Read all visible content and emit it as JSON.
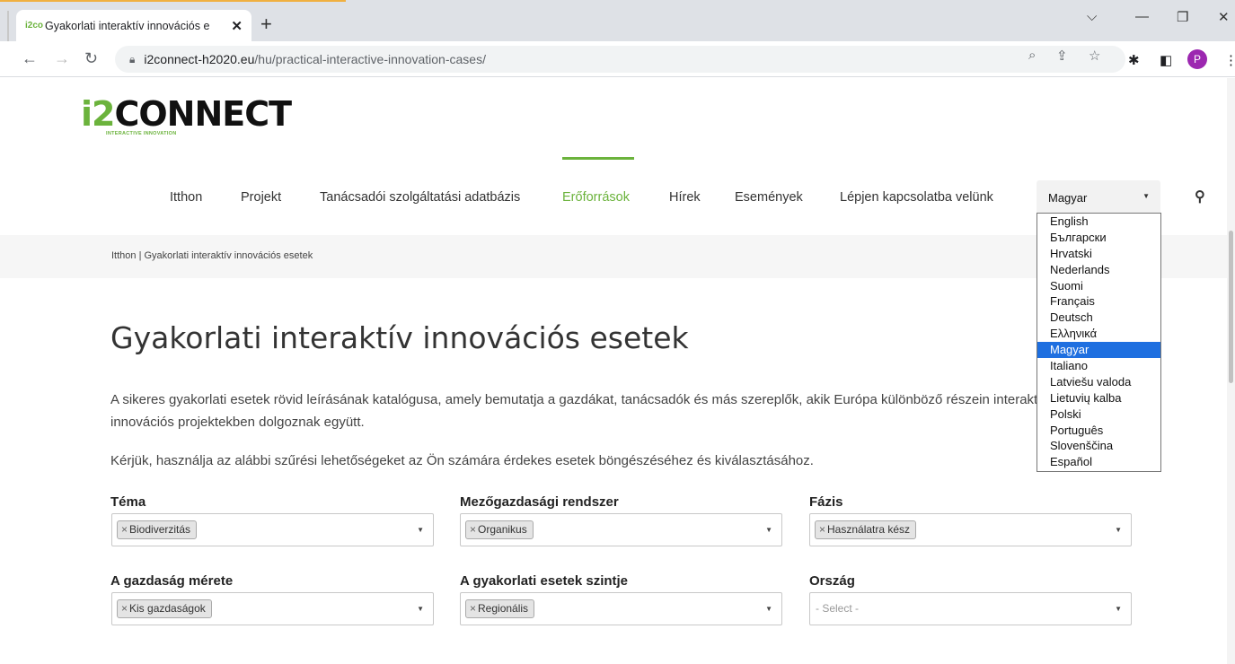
{
  "browser": {
    "tab_favicon": "i2co",
    "tab_title": "Gyakorlati interaktív innovációs e",
    "tab_close": "✕",
    "new_tab": "+",
    "url_host": "i2connect-h2020.eu",
    "url_path": "/hu/practical-interactive-innovation-cases/",
    "profile_initial": "P"
  },
  "logo": {
    "prefix": "i2",
    "suffix": "CONNECT",
    "tagline": "INTERACTIVE INNOVATION"
  },
  "nav": {
    "items": [
      "Itthon",
      "Projekt",
      "Tanácsadói szolgáltatási adatbázis",
      "Erőforrások",
      "Hírek",
      "Események",
      "Lépjen kapcsolatba velünk"
    ],
    "active": "Erőforrások",
    "language_value": "Magyar"
  },
  "languages": [
    "English",
    "Български",
    "Hrvatski",
    "Nederlands",
    "Suomi",
    "Français",
    "Deutsch",
    "Ελληνικά",
    "Magyar",
    "Italiano",
    "Latviešu valoda",
    "Lietuvių kalba",
    "Polski",
    "Português",
    "Slovenščina",
    "Español"
  ],
  "breadcrumb": "Itthon  |  Gyakorlati interaktív innovációs esetek",
  "page": {
    "title": "Gyakorlati interaktív innovációs esetek",
    "intro": "A sikeres gyakorlati esetek rövid leírásának katalógusa, amely bemutatja a gazdákat, tanácsadók és más szereplők, akik Európa különböző részein interaktív innovációs projektekben dolgoznak együtt.",
    "instructions": "Kérjük, használja az alábbi szűrési lehetőségeket az Ön számára érdekes esetek böngészéséhez és kiválasztásához."
  },
  "filters": {
    "tema": {
      "label": "Téma",
      "value": "Biodiverzitás"
    },
    "rendszer": {
      "label": "Mezőgazdasági rendszer",
      "value": "Organikus"
    },
    "fazis": {
      "label": "Fázis",
      "value": "Használatra kész"
    },
    "meret": {
      "label": "A gazdaság mérete",
      "value": "Kis gazdaságok"
    },
    "szint": {
      "label": "A gyakorlati esetek szintje",
      "value": "Regionális"
    },
    "orszag": {
      "label": "Ország",
      "placeholder": "- Select -"
    }
  }
}
